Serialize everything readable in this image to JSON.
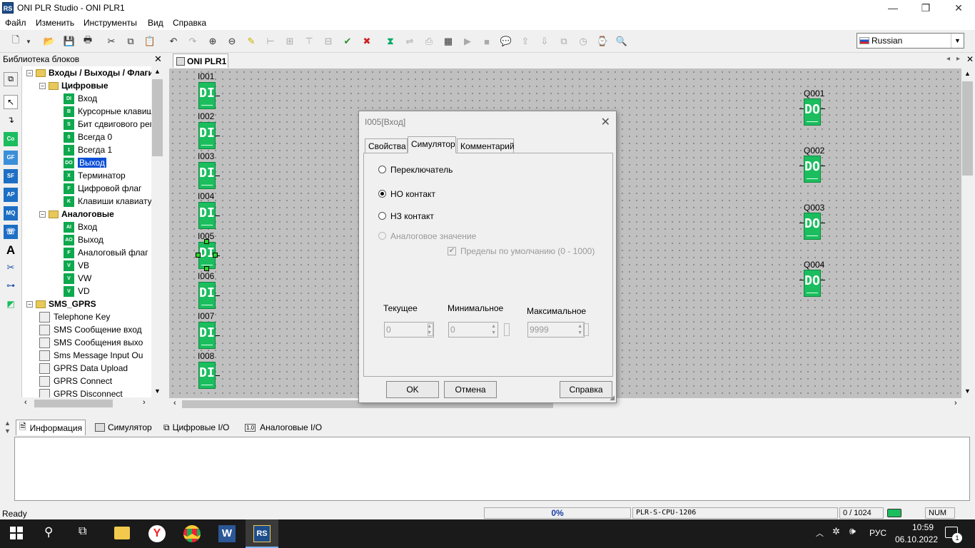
{
  "window": {
    "title": "ONI PLR Studio - ONI PLR1",
    "icon_text": "RS"
  },
  "menu": [
    "Файл",
    "Изменить",
    "Инструменты",
    "Вид",
    "Справка"
  ],
  "language": {
    "selected": "Russian"
  },
  "library": {
    "title": "Библиотека блоков",
    "tree": [
      {
        "label": "Входы / Выходы / Флаги",
        "level": 0,
        "type": "folder"
      },
      {
        "label": "Цифровые",
        "level": 1,
        "type": "folder"
      },
      {
        "label": "Вход",
        "level": 2,
        "icon": "DI"
      },
      {
        "label": "Курсорные клавиш",
        "level": 2,
        "icon": "B"
      },
      {
        "label": "Бит сдвигового рег",
        "level": 2,
        "icon": "S"
      },
      {
        "label": "Всегда 0",
        "level": 2,
        "icon": "0"
      },
      {
        "label": "Всегда 1",
        "level": 2,
        "icon": "1"
      },
      {
        "label": "Выход",
        "level": 2,
        "icon": "DO",
        "selected": true
      },
      {
        "label": "Терминатор",
        "level": 2,
        "icon": "X"
      },
      {
        "label": "Цифровой флаг",
        "level": 2,
        "icon": "F"
      },
      {
        "label": "Клавиши клавиату",
        "level": 2,
        "icon": "K"
      },
      {
        "label": "Аналоговые",
        "level": 1,
        "type": "folder"
      },
      {
        "label": "Вход",
        "level": 2,
        "icon": "AI"
      },
      {
        "label": "Выход",
        "level": 2,
        "icon": "AO"
      },
      {
        "label": "Аналоговый флаг",
        "level": 2,
        "icon": "F"
      },
      {
        "label": "VB",
        "level": 2,
        "icon": "V"
      },
      {
        "label": "VW",
        "level": 2,
        "icon": "V"
      },
      {
        "label": "VD",
        "level": 2,
        "icon": "V"
      },
      {
        "label": "SMS_GPRS",
        "level": 0,
        "type": "folder"
      },
      {
        "label": "Telephone Key",
        "level": 1,
        "icon": "g"
      },
      {
        "label": "SMS Сообщение вход",
        "level": 1,
        "icon": "g"
      },
      {
        "label": "SMS Сообщения выхо",
        "level": 1,
        "icon": "g"
      },
      {
        "label": "Sms Message Input Ou",
        "level": 1,
        "icon": "g"
      },
      {
        "label": "GPRS Data Upload",
        "level": 1,
        "icon": "g"
      },
      {
        "label": "GPRS Connect",
        "level": 1,
        "icon": "g"
      },
      {
        "label": "GPRS Disconnect",
        "level": 1,
        "icon": "g"
      }
    ],
    "left_tools": [
      "Co",
      "GF",
      "SF",
      "AP",
      "MQ"
    ]
  },
  "document": {
    "tab": "ONI PLR1"
  },
  "canvas": {
    "inputs": [
      "I001",
      "I002",
      "I003",
      "I004",
      "I005",
      "I006",
      "I007",
      "I008"
    ],
    "input_block_text": "DI",
    "outputs": [
      "Q001",
      "Q002",
      "Q003",
      "Q004"
    ],
    "output_block_text": "DO"
  },
  "dialog": {
    "title": "I005[Вход]",
    "tabs": [
      "Свойства",
      "Симулятор",
      "Комментарий"
    ],
    "active_tab": "Симулятор",
    "radio_switch": "Переключатель",
    "radio_no": "НО контакт",
    "radio_nc": "НЗ контакт",
    "radio_analog": "Аналоговое значение",
    "checkbox_default": "Пределы по умолчанию (0 - 1000)",
    "label_current": "Текущее",
    "label_min": "Минимальное",
    "label_max": "Максимальное",
    "value_current": "0",
    "value_min": "0",
    "value_max": "9999",
    "btn_ok": "OK",
    "btn_cancel": "Отмена",
    "btn_help": "Справка"
  },
  "bottom_tabs": [
    "Информация",
    "Симулятор",
    "Цифровые I/O",
    "Аналоговые I/O"
  ],
  "status": {
    "ready": "Ready",
    "progress": "0%",
    "cpu": "PLR-S-CPU-1206",
    "count": "0 / 1024",
    "num": "NUM"
  },
  "taskbar": {
    "lang": "РУС",
    "time": "10:59",
    "date": "06.10.2022",
    "notif_count": "1",
    "active_app": "RS"
  }
}
